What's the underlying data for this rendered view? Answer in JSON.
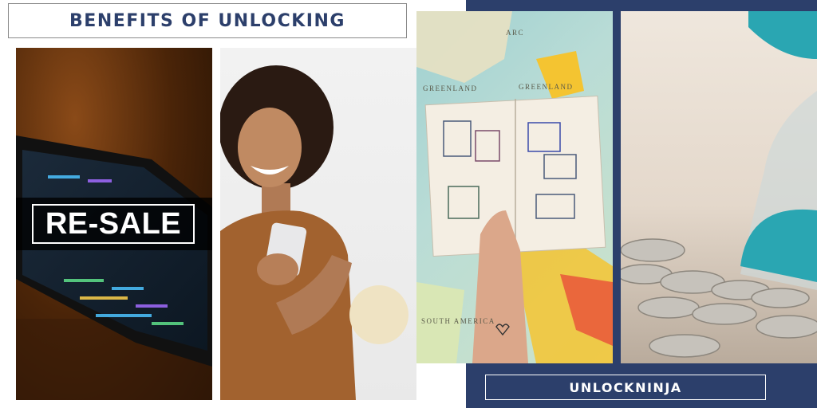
{
  "header": {
    "title": "BENEFITS OF UNLOCKING"
  },
  "panels": {
    "phone": {
      "overlay_label": "RE-SALE"
    },
    "woman": {},
    "map": {
      "map_labels": [
        "ARC",
        "GREENLAND",
        "GREENLAND",
        "SOUTH AMERICA"
      ]
    },
    "coins": {}
  },
  "footer": {
    "brand": "UNLOCKNINJA"
  },
  "colors": {
    "navy": "#2c3f6b",
    "cream": "#efe3c3",
    "white": "#ffffff"
  }
}
